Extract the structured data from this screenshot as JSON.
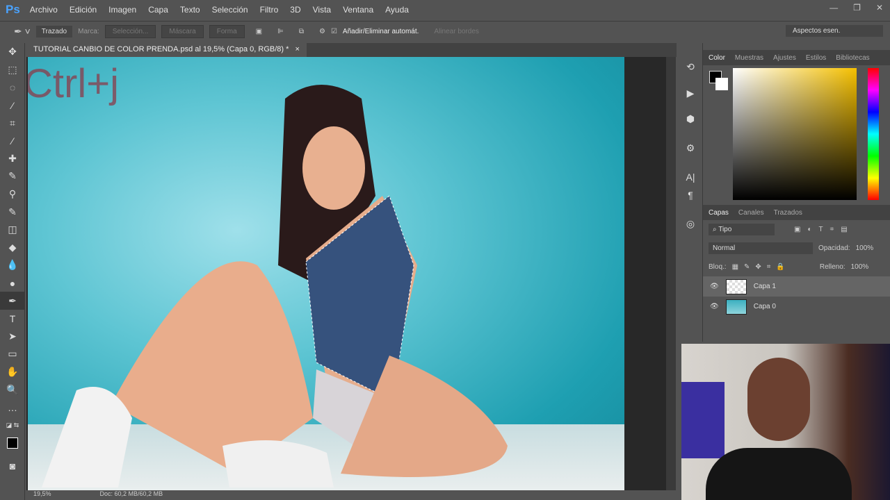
{
  "app": {
    "logo": "Ps",
    "menu": [
      "Archivo",
      "Edición",
      "Imagen",
      "Capa",
      "Texto",
      "Selección",
      "Filtro",
      "3D",
      "Vista",
      "Ventana",
      "Ayuda"
    ]
  },
  "options": {
    "mode": "Trazado",
    "marca_label": "Marca:",
    "seleccion": "Selección...",
    "mascara": "Máscara",
    "forma": "Forma",
    "auto_add": "Añadir/Eliminar automát.",
    "align_edges": "Alinear bordes",
    "workspace": "Aspectos esen."
  },
  "document": {
    "tab": "TUTORIAL CANBIO DE COLOR PRENDA.psd al 19,5% (Capa 0, RGB/8) *",
    "overlay": "Ctrl+j"
  },
  "status": {
    "zoom": "19,5%",
    "doc": "Doc: 60,2 MB/60,2 MB"
  },
  "color_panel": {
    "tabs": [
      "Color",
      "Muestras",
      "Ajustes",
      "Estilos",
      "Bibliotecas"
    ]
  },
  "layers_panel": {
    "tabs": [
      "Capas",
      "Canales",
      "Trazados"
    ],
    "filter": "Tipo",
    "blend": "Normal",
    "opacity_label": "Opacidad:",
    "opacity": "100%",
    "lock_label": "Bloq.:",
    "fill_label": "Relleno:",
    "fill": "100%",
    "layers": [
      {
        "name": "Capa 1"
      },
      {
        "name": "Capa 0"
      }
    ]
  }
}
